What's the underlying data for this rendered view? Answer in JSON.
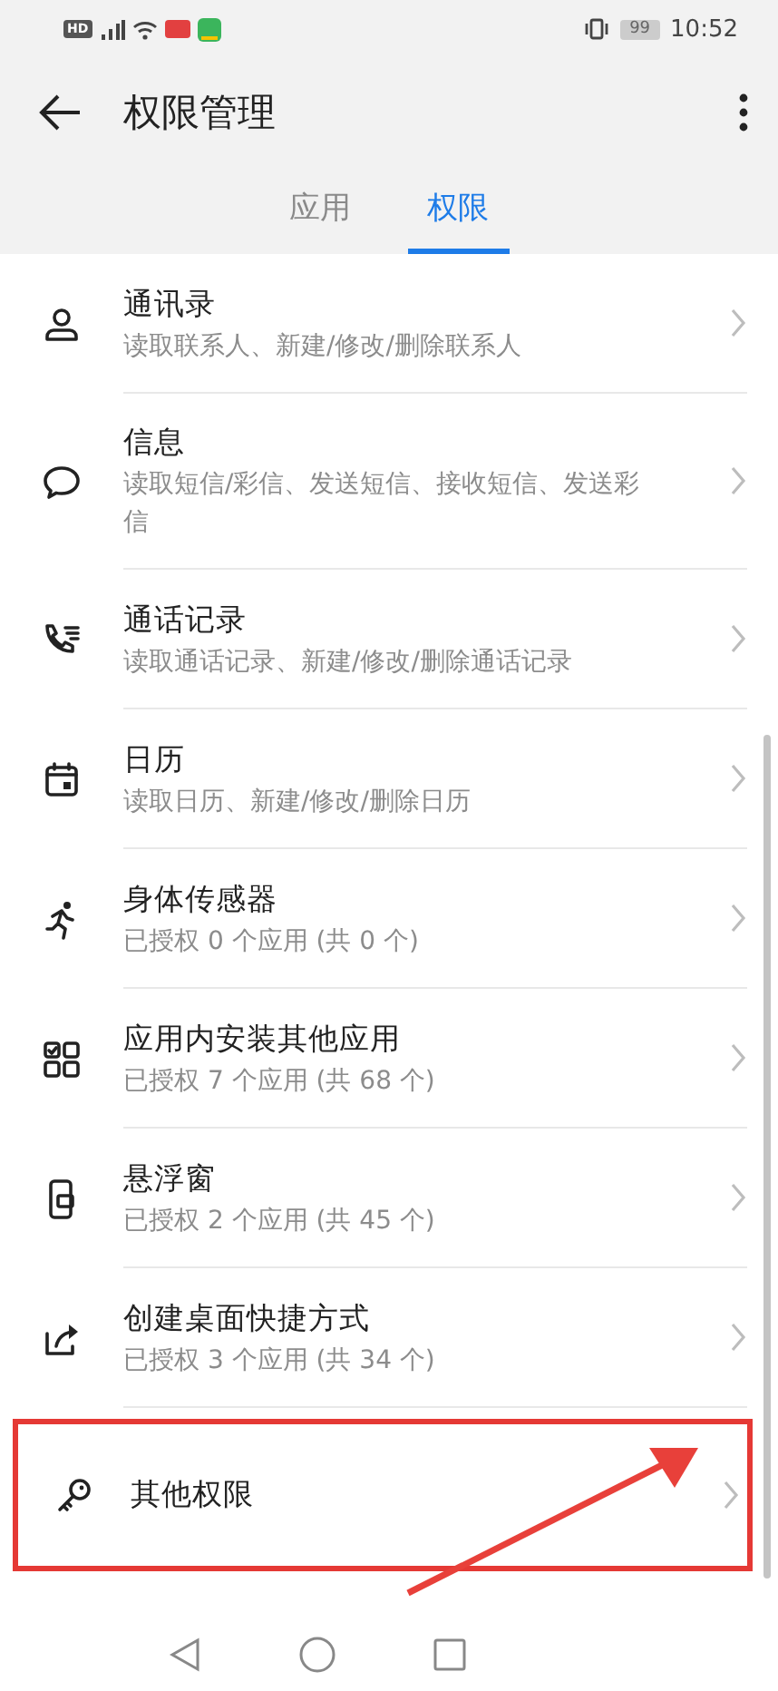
{
  "status_bar": {
    "hd": "HD",
    "battery": "99",
    "time": "10:52"
  },
  "header": {
    "title": "权限管理"
  },
  "tabs": [
    {
      "label": "应用",
      "selected": false
    },
    {
      "label": "权限",
      "selected": true
    }
  ],
  "permissions": [
    {
      "title": "通讯录",
      "description": "读取联系人、新建/修改/删除联系人"
    },
    {
      "title": "信息",
      "description": "读取短信/彩信、发送短信、接收短信、发送彩信"
    },
    {
      "title": "通话记录",
      "description": "读取通话记录、新建/修改/删除通话记录"
    },
    {
      "title": "日历",
      "description": "读取日历、新建/修改/删除日历"
    },
    {
      "title": "身体传感器",
      "description": "已授权 0 个应用 (共 0 个)"
    },
    {
      "title": "应用内安装其他应用",
      "description": "已授权 7 个应用 (共 68 个)"
    },
    {
      "title": "悬浮窗",
      "description": "已授权 2 个应用 (共 45 个)"
    },
    {
      "title": "创建桌面快捷方式",
      "description": "已授权 3 个应用 (共 34 个)"
    },
    {
      "title": "其他权限",
      "highlighted": true
    }
  ]
}
